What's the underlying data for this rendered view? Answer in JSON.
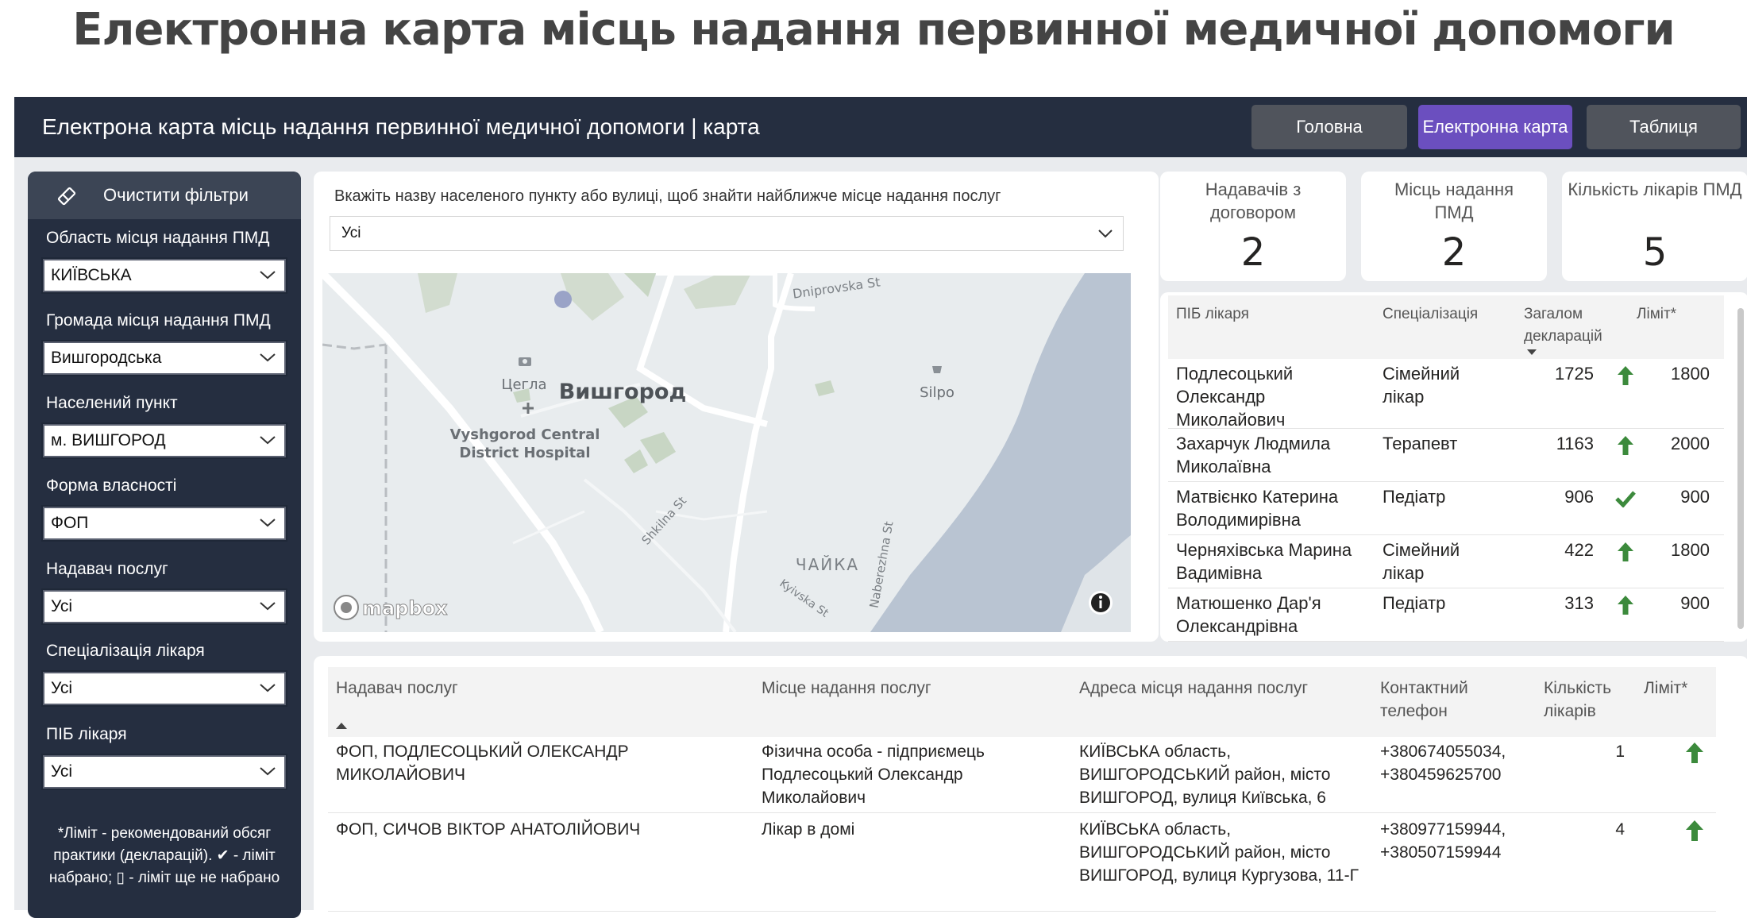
{
  "page_title": "Електронна карта місць надання первинної медичної допомоги",
  "topbar": {
    "title": "Електрона карта місць надання первинної медичної допомоги | карта",
    "nav": {
      "main": "Головна",
      "map": "Електронна карта",
      "table": "Таблиця"
    }
  },
  "filters": {
    "clear_label": "Очистити фільтри",
    "items": [
      {
        "label": "Область місця надання ПМД",
        "value": "КИЇВСЬКА"
      },
      {
        "label": "Громада місця надання ПМД",
        "value": "Вишгородська"
      },
      {
        "label": "Населений пункт",
        "value": "м. ВИШГОРОД"
      },
      {
        "label": "Форма власності",
        "value": "ФОП"
      },
      {
        "label": "Надавач послуг",
        "value": "Усі"
      },
      {
        "label": "Спеціалізація лікаря",
        "value": "Усі"
      },
      {
        "label": "ПІБ лікаря",
        "value": "Усі"
      }
    ],
    "footnote": "*Ліміт - рекомендований обсяг практики (декларацій). ✔ - ліміт набрано; ▯ - ліміт ще не набрано"
  },
  "search": {
    "label": "Вкажіть назву населеного пункту або вулиці, щоб знайти найближче місце надання послуг",
    "value": "Усі"
  },
  "map": {
    "city_label": "Вишгород",
    "labels": {
      "church": "Цегла",
      "hospital": "Vyshgorod Central\nDistrict Hospital",
      "shop": "Silpo",
      "district": "ЧАЙКА",
      "st_dniprovska": "Dniprovska St",
      "st_shkilna": "Shkilna St",
      "st_naberezhna": "Naberezhna St",
      "st_kyivska": "Kyivska St"
    },
    "attribution": "mapbox"
  },
  "kpis": [
    {
      "label": "Надавачів з договором",
      "value": "2"
    },
    {
      "label": "Місць надання ПМД",
      "value": "2"
    },
    {
      "label": "Кількість лікарів ПМД",
      "value": "5"
    }
  ],
  "doctors": {
    "headers": {
      "name": "ПІБ лікаря",
      "spec": "Спеціалізація",
      "total": "Загалом декларацій",
      "limit": "Ліміт*"
    },
    "rows": [
      {
        "name": "Подлесоцький Олександр Миколайович",
        "spec": "Сімейний лікар",
        "total": "1725",
        "status": "up",
        "limit": "1800"
      },
      {
        "name": "Захарчук Людмила Миколаївна",
        "spec": "Терапевт",
        "total": "1163",
        "status": "up",
        "limit": "2000"
      },
      {
        "name": "Матвієнко Катерина Володимирівна",
        "spec": "Педіатр",
        "total": "906",
        "status": "check",
        "limit": "900"
      },
      {
        "name": "Черняхівська Марина Вадимівна",
        "spec": "Сімейний лікар",
        "total": "422",
        "status": "up",
        "limit": "1800"
      },
      {
        "name": "Матюшенко Дар'я Олександрівна",
        "spec": "Педіатр",
        "total": "313",
        "status": "up",
        "limit": "900"
      }
    ]
  },
  "providers": {
    "headers": {
      "provider": "Надавач послуг",
      "place": "Місце надання послуг",
      "address": "Адреса місця надання послуг",
      "phone": "Контактний телефон",
      "count": "Кількість лікарів",
      "limit": "Ліміт*"
    },
    "rows": [
      {
        "provider": "ФОП, ПОДЛЕСОЦЬКИЙ ОЛЕКСАНДР МИКОЛАЙОВИЧ",
        "place": "Фізична особа - підприємець Подлесоцький Олександр Миколайович",
        "address": "КИЇВСЬКА область, ВИШГОРОДСЬКИЙ район, місто ВИШГОРОД, вулиця Київська, 6",
        "phone": "+380674055034, +380459625700",
        "count": "1",
        "status": "up"
      },
      {
        "provider": "ФОП, СИЧОВ ВІКТОР АНАТОЛІЙОВИЧ",
        "place": "Лікар в домі",
        "address": "КИЇВСЬКА область, ВИШГОРОДСЬКИЙ район, місто ВИШГОРОД, вулиця Кургузова, 11-Г",
        "phone": "+380977159944, +380507159944",
        "count": "4",
        "status": "up"
      }
    ]
  },
  "colors": {
    "topbar": "#252e40",
    "accent": "#6b4fbf",
    "arrow": "#3c8a3c",
    "water": "#b9c4d2"
  }
}
